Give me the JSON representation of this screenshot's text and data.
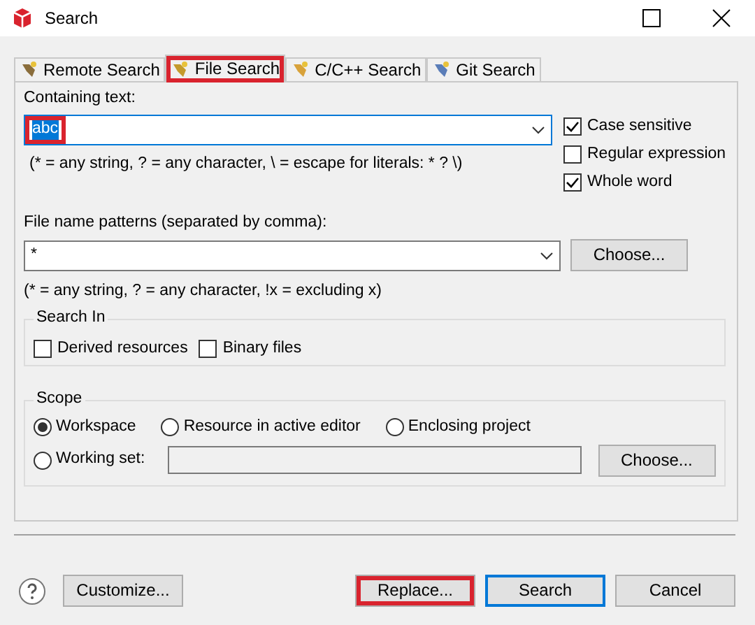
{
  "window": {
    "title": "Search"
  },
  "tabs": [
    {
      "label": "Remote Search",
      "selected": false,
      "highlighted": false
    },
    {
      "label": "File Search",
      "selected": true,
      "highlighted": true
    },
    {
      "label": "C/C++ Search",
      "selected": false,
      "highlighted": false
    },
    {
      "label": "Git Search",
      "selected": false,
      "highlighted": false
    }
  ],
  "containing_text": {
    "label": "Containing text:",
    "value": "abc",
    "highlighted": true,
    "hint": "(* = any string, ? = any character, \\ = escape for literals: * ? \\)"
  },
  "options": [
    {
      "label": "Case sensitive",
      "checked": true
    },
    {
      "label": "Regular expression",
      "checked": false
    },
    {
      "label": "Whole word",
      "checked": true
    }
  ],
  "file_name_patterns": {
    "label": "File name patterns (separated by comma):",
    "value": "*",
    "button": "Choose...",
    "hint": "(* = any string, ? = any character, !x = excluding x)"
  },
  "search_in": {
    "title": "Search In",
    "options": [
      {
        "label": "Derived resources",
        "checked": false
      },
      {
        "label": "Binary files",
        "checked": false
      }
    ]
  },
  "scope": {
    "title": "Scope",
    "options": [
      {
        "label": "Workspace",
        "selected": true
      },
      {
        "label": "Resource in active editor",
        "selected": false
      },
      {
        "label": "Enclosing project",
        "selected": false
      },
      {
        "label": "Working set:",
        "selected": false
      }
    ],
    "button": "Choose..."
  },
  "buttons": [
    {
      "label": "Customize...",
      "highlighted": false,
      "default": false
    },
    {
      "label": "Replace...",
      "highlighted": true,
      "default": false
    },
    {
      "label": "Search",
      "highlighted": false,
      "default": true
    },
    {
      "label": "Cancel",
      "highlighted": false,
      "default": false
    }
  ]
}
